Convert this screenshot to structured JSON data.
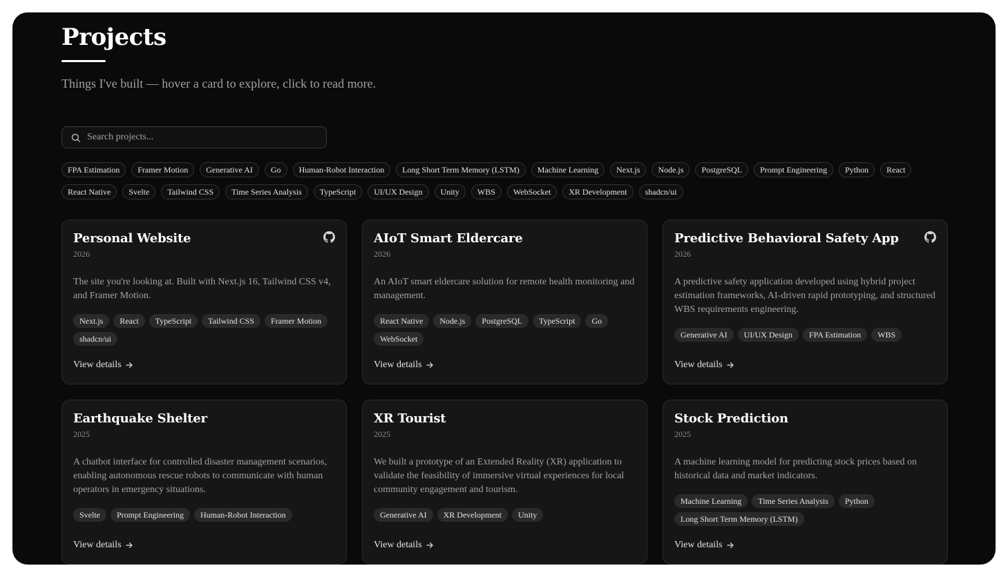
{
  "header": {
    "title": "Projects",
    "subtitle": "Things I've built — hover a card to explore, click to read more."
  },
  "search": {
    "placeholder": "Search projects...",
    "icon": "search-icon"
  },
  "filters": [
    "FPA Estimation",
    "Framer Motion",
    "Generative AI",
    "Go",
    "Human-Robot Interaction",
    "Long Short Term Memory (LSTM)",
    "Machine Learning",
    "Next.js",
    "Node.js",
    "PostgreSQL",
    "Prompt Engineering",
    "Python",
    "React",
    "React Native",
    "Svelte",
    "Tailwind CSS",
    "Time Series Analysis",
    "TypeScript",
    "UI/UX Design",
    "Unity",
    "WBS",
    "WebSocket",
    "XR Development",
    "shadcn/ui"
  ],
  "view_details_label": "View details",
  "projects": [
    {
      "title": "Personal Website",
      "year": "2026",
      "description": "The site you're looking at. Built with Next.js 16, Tailwind CSS v4, and Framer Motion.",
      "tags": [
        "Next.js",
        "React",
        "TypeScript",
        "Tailwind CSS",
        "Framer Motion",
        "shadcn/ui"
      ],
      "github": true
    },
    {
      "title": "AIoT Smart Eldercare",
      "year": "2026",
      "description": "An AIoT smart eldercare solution for remote health monitoring and management.",
      "tags": [
        "React Native",
        "Node.js",
        "PostgreSQL",
        "TypeScript",
        "Go",
        "WebSocket"
      ],
      "github": false
    },
    {
      "title": "Predictive Behavioral Safety App",
      "year": "2026",
      "description": "A predictive safety application developed using hybrid project estimation frameworks, AI-driven rapid prototyping, and structured WBS requirements engineering.",
      "tags": [
        "Generative AI",
        "UI/UX Design",
        "FPA Estimation",
        "WBS"
      ],
      "github": true
    },
    {
      "title": "Earthquake Shelter",
      "year": "2025",
      "description": "A chatbot interface for controlled disaster management scenarios, enabling autonomous rescue robots to communicate with human operators in emergency situations.",
      "tags": [
        "Svelte",
        "Prompt Engineering",
        "Human-Robot Interaction"
      ],
      "github": false
    },
    {
      "title": "XR Tourist",
      "year": "2025",
      "description": "We built a prototype of an Extended Reality (XR) application to validate the feasibility of immersive virtual experiences for local community engagement and tourism.",
      "tags": [
        "Generative AI",
        "XR Development",
        "Unity"
      ],
      "github": false
    },
    {
      "title": "Stock Prediction",
      "year": "2025",
      "description": "A machine learning model for predicting stock prices based on historical data and market indicators.",
      "tags": [
        "Machine Learning",
        "Time Series Analysis",
        "Python",
        "Long Short Term Memory (LSTM)"
      ],
      "github": false
    }
  ]
}
